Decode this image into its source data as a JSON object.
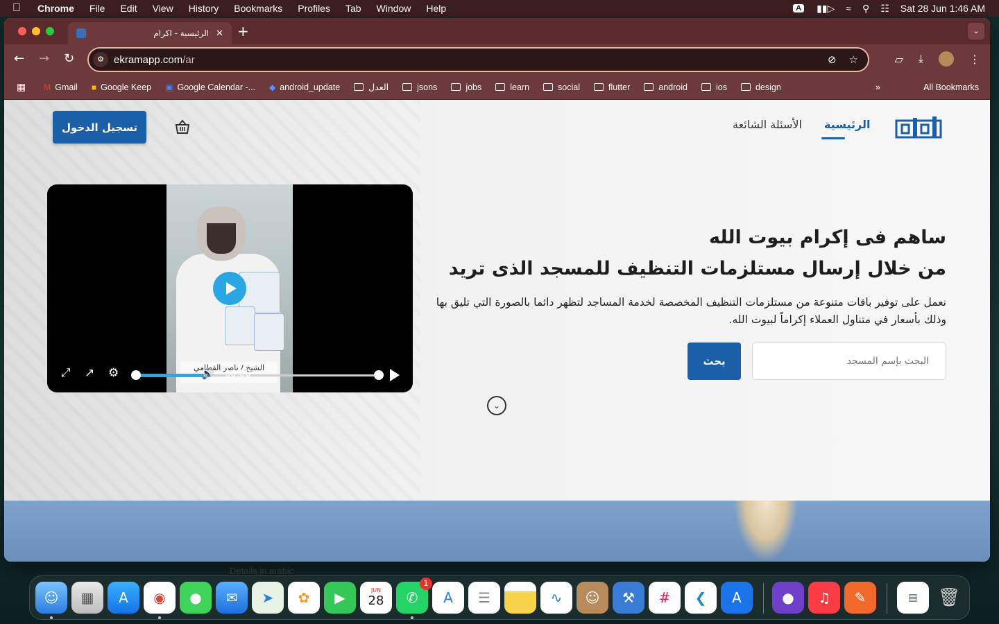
{
  "menubar": {
    "app_name": "Chrome",
    "items": [
      "File",
      "Edit",
      "View",
      "History",
      "Bookmarks",
      "Profiles",
      "Tab",
      "Window",
      "Help"
    ],
    "input_badge": "A",
    "clock": "Sat 28 Jun  1:46 AM"
  },
  "browser": {
    "tab_title": "الرئيسية - اكرام",
    "url_host": "ekramapp.com",
    "url_path": "/ar",
    "bookmarks": [
      {
        "label": "Gmail",
        "icon": "gmail-icon"
      },
      {
        "label": "Google Keep",
        "icon": "keep-icon"
      },
      {
        "label": "Google Calendar -...",
        "icon": "calendar-icon"
      },
      {
        "label": "android_update",
        "icon": "diamond-icon"
      },
      {
        "label": "العدل",
        "icon": "folder-icon"
      },
      {
        "label": "jsons",
        "icon": "folder-icon"
      },
      {
        "label": "jobs",
        "icon": "folder-icon"
      },
      {
        "label": "learn",
        "icon": "folder-icon"
      },
      {
        "label": "social",
        "icon": "folder-icon"
      },
      {
        "label": "flutter",
        "icon": "folder-icon"
      },
      {
        "label": "android",
        "icon": "folder-icon"
      },
      {
        "label": "ios",
        "icon": "folder-icon"
      },
      {
        "label": "design",
        "icon": "folder-icon"
      }
    ],
    "all_bookmarks": "All Bookmarks",
    "overflow": "»"
  },
  "site": {
    "login_label": "تسجيل الدخول",
    "nav": {
      "home": "الرئيسية",
      "faq": "الأسئلة الشائعة"
    },
    "hero": {
      "title_line1": "ساهم فى إكرام بيوت الله",
      "title_line2": "من خلال إرسال مستلزمات التنظيف للمسجد الذى تريد",
      "description": "نعمل على توفير باقات متنوعة من مستلزمات التنظيف المخصصة لخدمة المساجد لتظهر دائما بالصورة التي تليق بها وذلك بأسعار في متناول العملاء إكراماً لبيوت الله."
    },
    "search": {
      "placeholder": "البحث بإسم المسجد",
      "button": "بحث"
    },
    "video": {
      "time": "00:00",
      "caption": "الشيخ / ناصر القطامي",
      "progress_fraction": 0.3
    }
  },
  "dock": {
    "hover_label": "Details in arabic",
    "calendar_month": "JUN",
    "calendar_day": "28",
    "whatsapp_badge": "1"
  },
  "colors": {
    "brand_blue": "#1a5fa8",
    "video_accent": "#2aa6e3",
    "browser_frame": "#6c3a3b"
  }
}
